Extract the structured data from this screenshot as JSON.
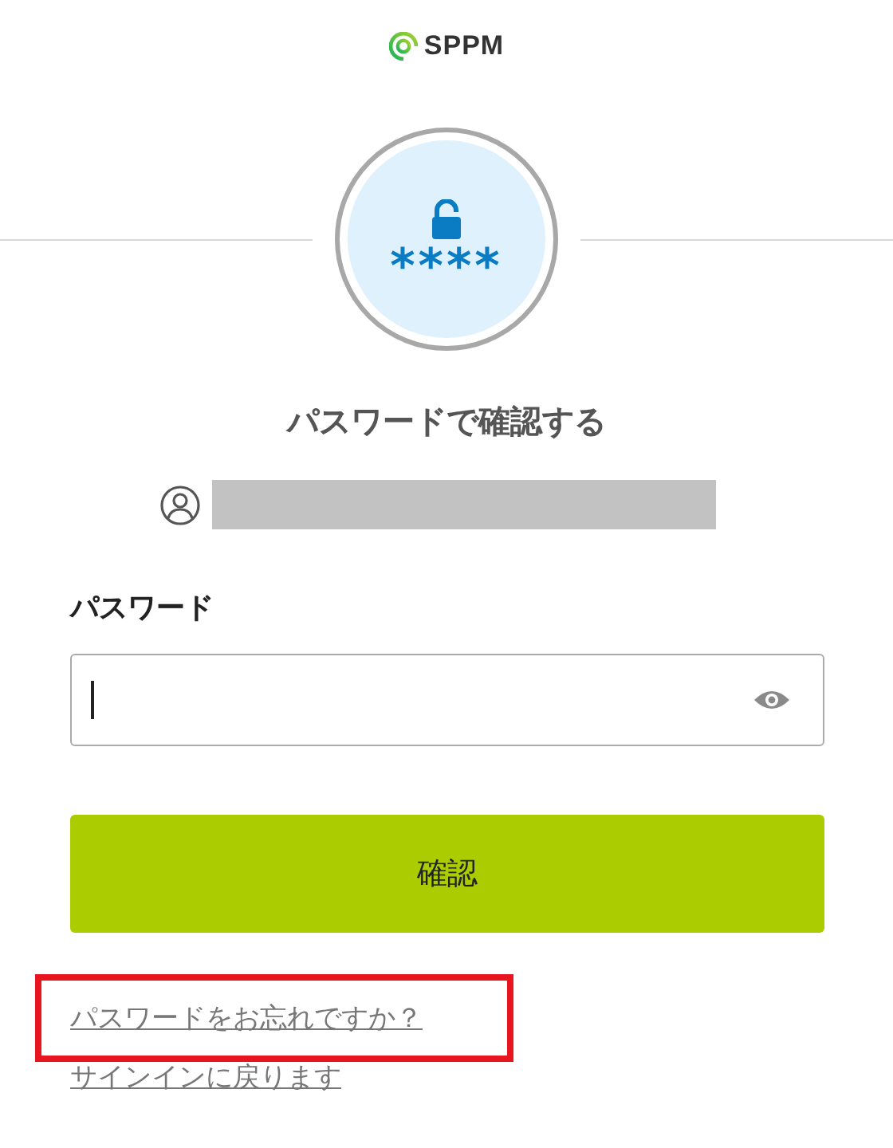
{
  "logo": {
    "text": "SPPM"
  },
  "badge": {
    "text": "****"
  },
  "title": "パスワードで確認する",
  "account": {
    "redacted": true
  },
  "password": {
    "label": "パスワード",
    "focused": true
  },
  "submit": {
    "label": "確認"
  },
  "links": [
    {
      "label": "パスワードをお忘れですか？",
      "highlighted": true
    },
    {
      "label": "サインインに戻ります",
      "highlighted": false
    }
  ]
}
